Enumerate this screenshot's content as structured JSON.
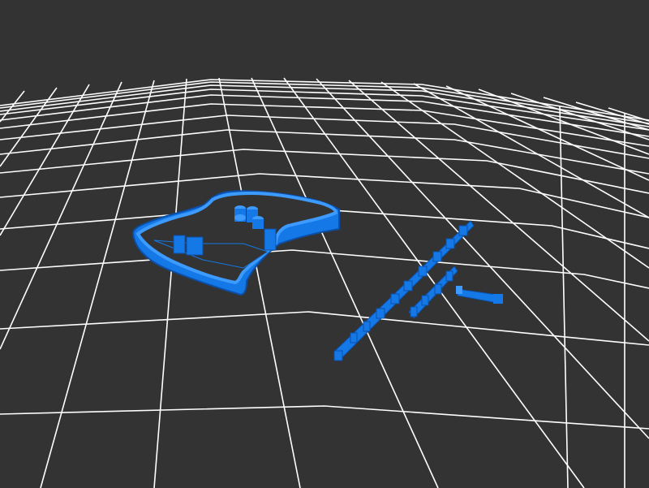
{
  "scene": {
    "background": "#333333",
    "grid_color": "#ffffff",
    "model_color": "#1479e6",
    "model_highlight": "#3d9bff",
    "model_shadow": "#0b4fa8"
  },
  "objects": [
    {
      "name": "guitar-body-cutter-outline"
    },
    {
      "name": "long-text-strip"
    },
    {
      "name": "short-text-strip"
    },
    {
      "name": "small-bar-piece"
    }
  ]
}
